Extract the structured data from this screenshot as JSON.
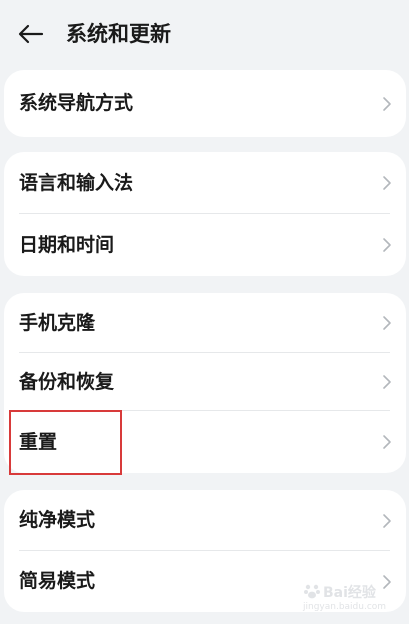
{
  "header": {
    "title": "系统和更新",
    "back_icon": "arrow-left-icon"
  },
  "groups": [
    {
      "items": [
        {
          "label": "系统导航方式"
        }
      ]
    },
    {
      "items": [
        {
          "label": "语言和输入法"
        },
        {
          "label": "日期和时间"
        }
      ]
    },
    {
      "items": [
        {
          "label": "手机克隆"
        },
        {
          "label": "备份和恢复"
        },
        {
          "label": "重置"
        }
      ]
    },
    {
      "items": [
        {
          "label": "纯净模式"
        },
        {
          "label": "简易模式"
        }
      ]
    }
  ],
  "highlight": {
    "target": "重置",
    "color": "#d83a3a"
  },
  "watermark": {
    "brand": "Bai经验",
    "url": "jingyan.baidu.com"
  }
}
